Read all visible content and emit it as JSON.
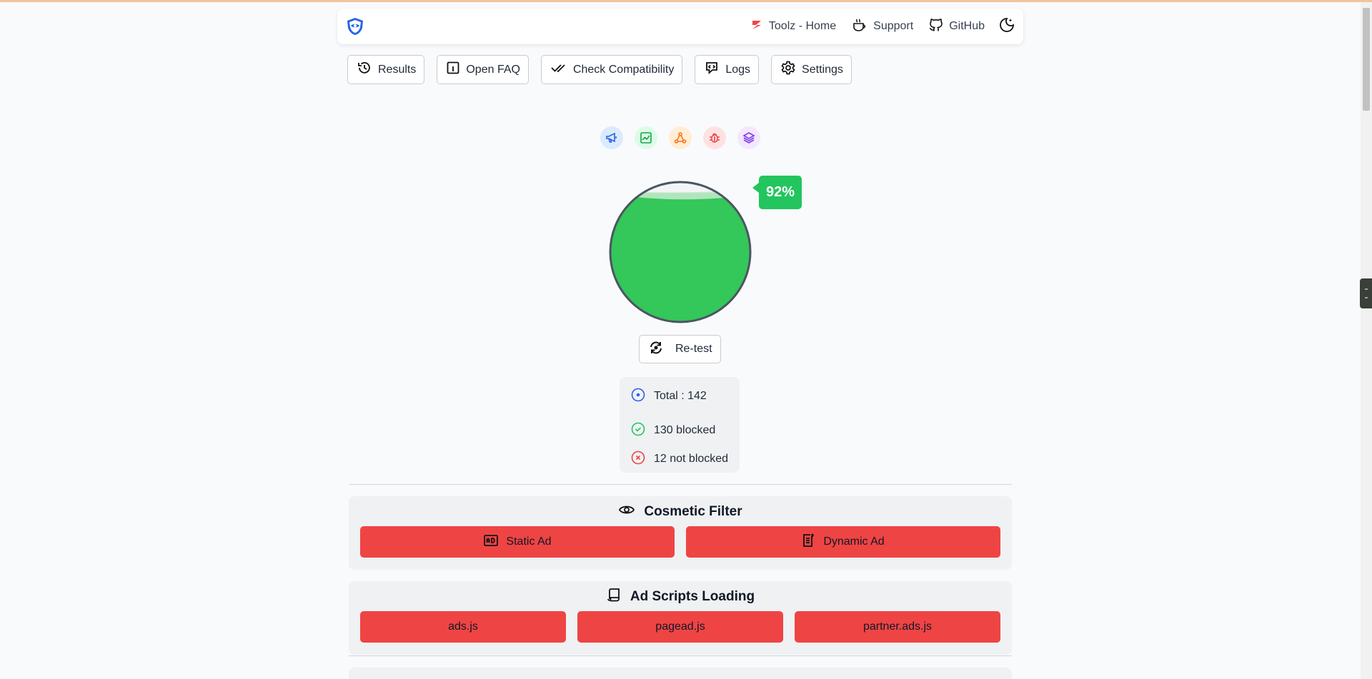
{
  "nav": {
    "logo": "shield-logo",
    "links": [
      {
        "label": "Toolz - Home",
        "icon": "toolz-logo-icon"
      },
      {
        "label": "Support",
        "icon": "coffee-icon"
      },
      {
        "label": "GitHub",
        "icon": "github-icon"
      }
    ],
    "theme_icon": "moon-icon"
  },
  "toolbar": {
    "results": "Results",
    "faq": "Open FAQ",
    "compatibility": "Check Compatibility",
    "logs": "Logs",
    "settings": "Settings"
  },
  "categories": [
    {
      "icon": "megaphone-icon",
      "color": "#3b82f6"
    },
    {
      "icon": "chart-icon",
      "color": "#22c55e"
    },
    {
      "icon": "network-icon",
      "color": "#f97316"
    },
    {
      "icon": "bug-icon",
      "color": "#ef4444"
    },
    {
      "icon": "layers-icon",
      "color": "#8b5cf6"
    }
  ],
  "score": {
    "percent_label": "92%",
    "fill_fraction": 0.92,
    "fill_color": "#34c759"
  },
  "retest_label": "Re-test",
  "stats": {
    "total": "Total : 142",
    "blocked": "130 blocked",
    "not_blocked": "12 not blocked"
  },
  "sections": {
    "cosmetic": {
      "title": "Cosmetic Filter",
      "buttons": [
        "Static Ad",
        "Dynamic Ad"
      ]
    },
    "scripts": {
      "title": "Ad Scripts Loading",
      "buttons": [
        "ads.js",
        "pagead.js",
        "partner.ads.js"
      ]
    }
  },
  "colors": {
    "not_blocked": "#ef4444",
    "blocked": "#22c55e",
    "accent": "#3b82f6"
  }
}
